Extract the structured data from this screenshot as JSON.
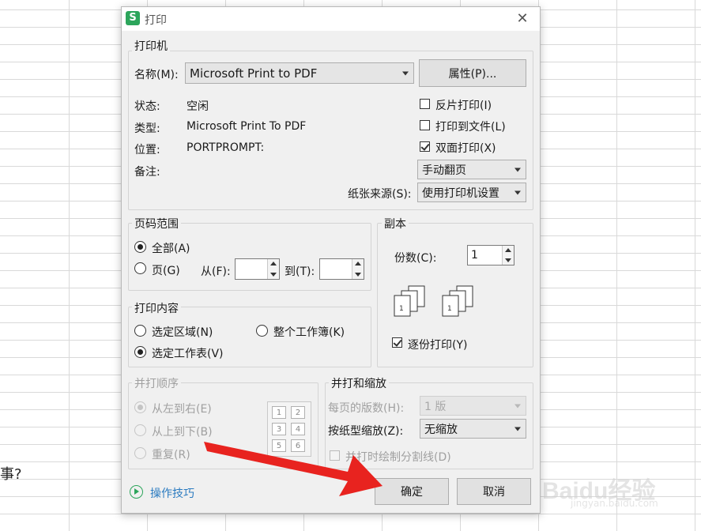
{
  "background": {
    "stray_text": "事?",
    "watermark": {
      "brand": "Baidu经验",
      "url": "jingyan.baidu.com"
    }
  },
  "dialog": {
    "icon_letter": "S",
    "title": "打印",
    "printer_group": {
      "legend": "打印机",
      "name_label": "名称(M):",
      "name_value": "Microsoft Print to PDF",
      "properties_button": "属性(P)...",
      "status_label": "状态:",
      "status_value": "空闲",
      "type_label": "类型:",
      "type_value": "Microsoft Print To PDF",
      "location_label": "位置:",
      "location_value": "PORTPROMPT:",
      "comment_label": "备注:",
      "reverse_print": {
        "label": "反片打印(I)",
        "checked": false
      },
      "print_to_file": {
        "label": "打印到文件(L)",
        "checked": false
      },
      "duplex": {
        "label": "双面打印(X)",
        "checked": true
      },
      "duplex_mode": "手动翻页",
      "paper_source_label": "纸张来源(S):",
      "paper_source_value": "使用打印机设置"
    },
    "page_range": {
      "legend": "页码范围",
      "all_label": "全部(A)",
      "pages_label": "页(G)",
      "from_label": "从(F):",
      "to_label": "到(T):",
      "selected": "all"
    },
    "copies": {
      "legend": "副本",
      "count_label": "份数(C):",
      "count_value": "1",
      "collate": {
        "label": "逐份打印(Y)",
        "checked": true
      }
    },
    "print_content": {
      "legend": "打印内容",
      "selection_label": "选定区域(N)",
      "workbook_label": "整个工作簿(K)",
      "worksheet_label": "选定工作表(V)",
      "selected": "worksheet"
    },
    "order": {
      "legend": "并打顺序",
      "left_right": "从左到右(E)",
      "top_bottom": "从上到下(B)",
      "repeat": "重复(R)",
      "preview_numbers": [
        "1",
        "2",
        "3",
        "4",
        "5",
        "6"
      ]
    },
    "zoom": {
      "legend": "并打和缩放",
      "pages_per_sheet_label": "每页的版数(H):",
      "pages_per_sheet_value": "1 版",
      "scale_label": "按纸型缩放(Z):",
      "scale_value": "无缩放",
      "draw_lines": {
        "label": "并打时绘制分割线(D)",
        "checked": false
      }
    },
    "tips_link": "操作技巧",
    "ok_button": "确定",
    "cancel_button": "取消"
  },
  "colors": {
    "annotation_arrow": "#e8231f",
    "tips_link": "#2b7bc0",
    "app_icon": "#2ca55b"
  }
}
